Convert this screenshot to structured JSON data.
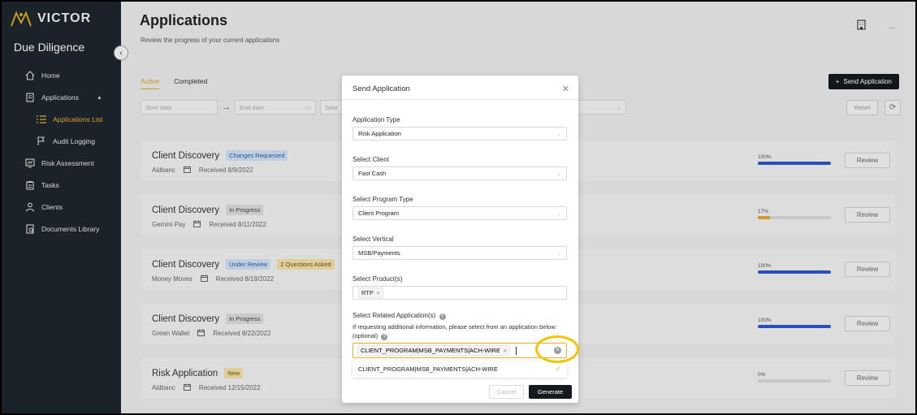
{
  "app": {
    "logo_text": "VICTOR",
    "module_title": "Due Diligence"
  },
  "sidebar": {
    "items": [
      {
        "label": "Home",
        "icon": "home-icon"
      },
      {
        "label": "Applications",
        "icon": "applications-icon"
      },
      {
        "label": "Applications List",
        "icon": "list-icon"
      },
      {
        "label": "Audit Logging",
        "icon": "flag-icon"
      },
      {
        "label": "Risk Assessment",
        "icon": "risk-icon"
      },
      {
        "label": "Tasks",
        "icon": "clipboard-icon"
      },
      {
        "label": "Clients",
        "icon": "user-icon"
      },
      {
        "label": "Documents Library",
        "icon": "document-icon"
      }
    ]
  },
  "page": {
    "title": "Applications",
    "subtitle": "Review the progress of your current applications",
    "more": "..."
  },
  "tabs": {
    "active": "Active",
    "completed": "Completed"
  },
  "send_application_label": "Send Application",
  "filters": {
    "start_date": "Start date",
    "end_date": "End date",
    "search": "Sear",
    "reset": "Reset"
  },
  "applications": [
    {
      "title": "Client Discovery",
      "badges": [
        "Changes Requested"
      ],
      "client": "Aidbanc",
      "received": "Received 8/9/2022",
      "progress_label": "100%",
      "progress": 1.0,
      "review": "Review"
    },
    {
      "title": "Client Discovery",
      "badges": [
        "In Progress"
      ],
      "client": "Gemini Pay",
      "received": "Received 8/11/2022",
      "progress_label": "17%",
      "progress": 0.17,
      "review": "Review"
    },
    {
      "title": "Client Discovery",
      "badges": [
        "Under Review",
        "2 Questions Asked"
      ],
      "client": "Money Moves",
      "received": "Received 8/19/2022",
      "progress_label": "100%",
      "progress": 1.0,
      "review": "Review"
    },
    {
      "title": "Client Discovery",
      "badges": [
        "In Progress"
      ],
      "client": "Green Wallet",
      "received": "Received 8/22/2022",
      "progress_label": "100%",
      "progress": 1.0,
      "review": "Review"
    },
    {
      "title": "Risk Application",
      "badges": [
        "New"
      ],
      "client": "Aidbanc",
      "received": "Received 12/15/2022",
      "progress_label": "0%",
      "progress": 0.0,
      "review": "Review"
    }
  ],
  "modal": {
    "title": "Send Application",
    "application_type": {
      "label": "Application Type",
      "value": "Risk Application"
    },
    "client": {
      "label": "Select Client",
      "value": "Fast Cash"
    },
    "program_type": {
      "label": "Select Program Type",
      "value": "Client Program"
    },
    "vertical": {
      "label": "Select Vertical",
      "value": "MSB/Payments"
    },
    "products": {
      "label": "Select Product(s)",
      "tags": [
        "RTP"
      ]
    },
    "related": {
      "label": "Select Related Application(s)",
      "description": "If requesting additional information, please select from an application below (optional)",
      "tags": [
        "CLIENT_PROGRAM|MSB_PAYMENTS|ACH-WIRE"
      ],
      "options": [
        "CLIENT_PROGRAM|MSB_PAYMENTS|ACH-WIRE"
      ]
    },
    "cancel": "Cancel",
    "generate": "Generate"
  },
  "colors": {
    "accent": "#e6b22e",
    "progress_blue": "#2f56c7",
    "progress_amber": "#e0a62a",
    "sidebar_bg": "#1e262e",
    "highlight": "#f4c400"
  }
}
